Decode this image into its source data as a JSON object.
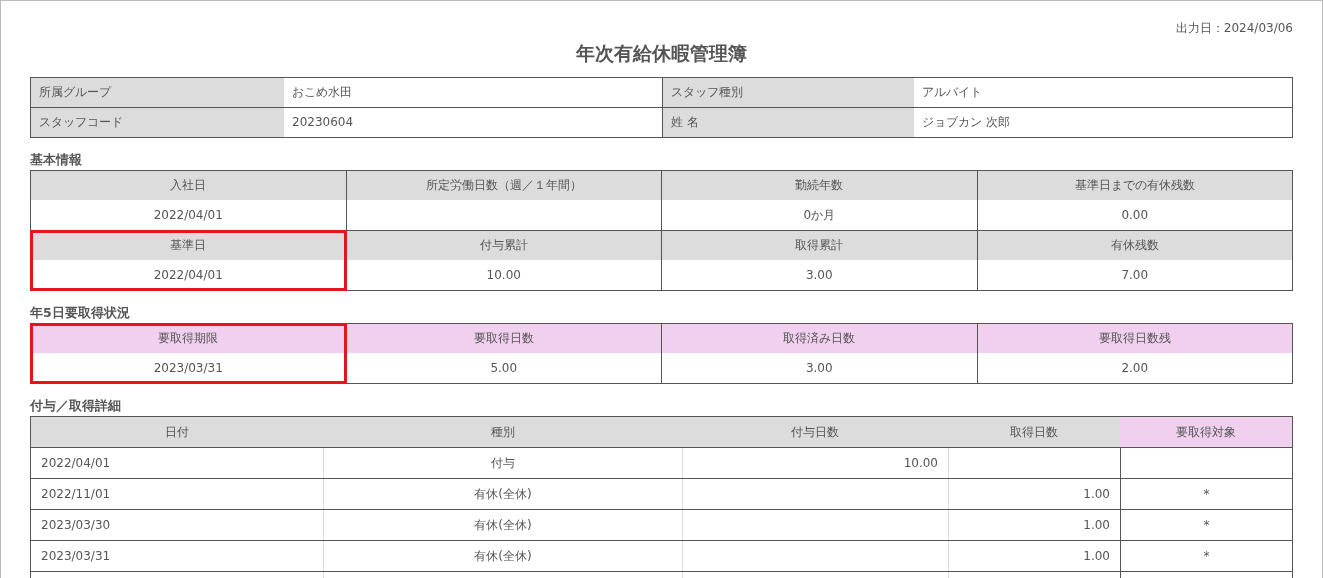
{
  "output_date": "出力日：2024/03/06",
  "title": "年次有給休暇管理簿",
  "staff_info": [
    {
      "label": "所属グループ",
      "value": "おこめ水田"
    },
    {
      "label": "スタッフ種別",
      "value": "アルバイト"
    },
    {
      "label": "スタッフコード",
      "value": "20230604"
    },
    {
      "label": "姓 名",
      "value": "ジョブカン 次郎"
    }
  ],
  "sections": [
    {
      "heading": "基本情報",
      "stats": [
        {
          "label": "入社日",
          "value": "2022/04/01",
          "color": "#dcdcdc",
          "highlighted": false
        },
        {
          "label": "所定労働日数（週／１年間）",
          "color": "#dcdcdc",
          "highlighted": false
        },
        {
          "label": "勤続年数",
          "value": "0か月",
          "color": "#dcdcdc",
          "highlighted": false
        },
        {
          "label": "基準日までの有休残数",
          "value": "0.00",
          "color": "#dcdcdc",
          "highlighted": false
        },
        {
          "label": "基準日",
          "value": "2022/04/01",
          "color": "#dcdcdc",
          "highlighted": true
        },
        {
          "label": "付与累計",
          "value": "10.00",
          "color": "#dcdcdc",
          "highlighted": false
        },
        {
          "label": "取得累計",
          "value": "3.00",
          "color": "#dcdcdc",
          "highlighted": false
        },
        {
          "label": "有休残数",
          "value": "7.00",
          "color": "#dcdcdc",
          "highlighted": false
        }
      ]
    },
    {
      "heading": "年5日要取得状況",
      "stats": [
        {
          "label": "要取得期限",
          "value": "2023/03/31",
          "color": "#f0d0ee",
          "highlighted": true
        },
        {
          "label": "要取得日数",
          "value": "5.00",
          "color": "#f0d0ee",
          "highlighted": false
        },
        {
          "label": "取得済み日数",
          "value": "3.00",
          "color": "#f0d0ee",
          "highlighted": false
        },
        {
          "label": "要取得日数残",
          "value": "2.00",
          "color": "#f0d0ee",
          "highlighted": false
        }
      ]
    }
  ],
  "details": {
    "heading": "付与／取得詳細",
    "columns": [
      {
        "label": "日付",
        "color": "#dcdcdc"
      },
      {
        "label": "種別",
        "color": "#dcdcdc"
      },
      {
        "label": "付与日数",
        "color": "#dcdcdc"
      },
      {
        "label": "取得日数",
        "color": "#dcdcdc"
      },
      {
        "label": "要取得対象",
        "color": "#f0d0ee"
      }
    ],
    "rows": [
      [
        "2022/04/01",
        "付与",
        "10.00",
        null,
        null
      ],
      [
        "2022/11/01",
        "有休(全休)",
        null,
        "1.00",
        "*"
      ],
      [
        "2023/03/30",
        "有休(全休)",
        null,
        "1.00",
        "*"
      ],
      [
        "2023/03/31",
        "有休(全休)",
        null,
        "1.00",
        "*"
      ]
    ]
  }
}
